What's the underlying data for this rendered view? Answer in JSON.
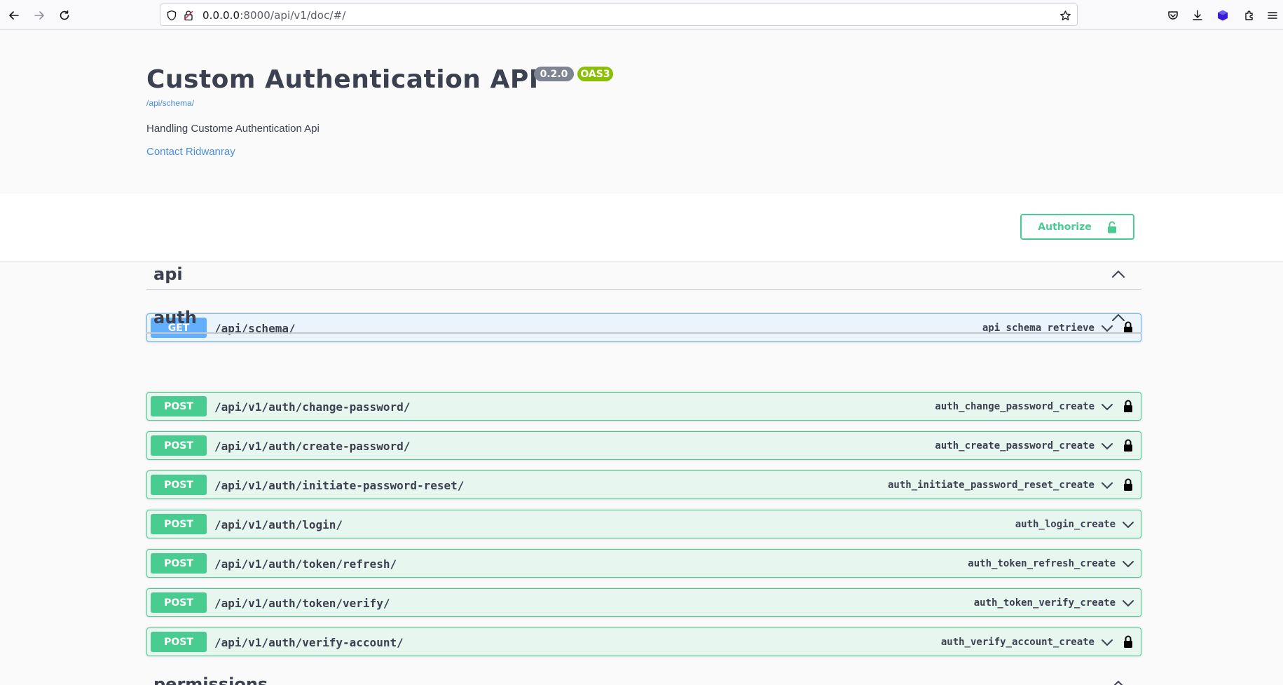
{
  "browser": {
    "url_host": "0.0.0.0",
    "url_path": ":8000/api/v1/doc/#/"
  },
  "info": {
    "title": "Custom Authentication API",
    "version_badge": "0.2.0",
    "oas_badge": "OAS3",
    "schema_link": "/api/schema/",
    "description": "Handling Custome Authentication Api",
    "contact_link": "Contact Ridwanray"
  },
  "scheme": {
    "authorize_label": "Authorize"
  },
  "tags": [
    {
      "name": "api",
      "operations": [
        {
          "method": "GET",
          "path": "/api/schema/",
          "operation_id": "api_schema_retrieve",
          "locked": true
        }
      ]
    },
    {
      "name": "auth",
      "operations": [
        {
          "method": "POST",
          "path": "/api/v1/auth/change-password/",
          "operation_id": "auth_change_password_create",
          "locked": true
        },
        {
          "method": "POST",
          "path": "/api/v1/auth/create-password/",
          "operation_id": "auth_create_password_create",
          "locked": true
        },
        {
          "method": "POST",
          "path": "/api/v1/auth/initiate-password-reset/",
          "operation_id": "auth_initiate_password_reset_create",
          "locked": true
        },
        {
          "method": "POST",
          "path": "/api/v1/auth/login/",
          "operation_id": "auth_login_create",
          "locked": false
        },
        {
          "method": "POST",
          "path": "/api/v1/auth/token/refresh/",
          "operation_id": "auth_token_refresh_create",
          "locked": false
        },
        {
          "method": "POST",
          "path": "/api/v1/auth/token/verify/",
          "operation_id": "auth_token_verify_create",
          "locked": false
        },
        {
          "method": "POST",
          "path": "/api/v1/auth/verify-account/",
          "operation_id": "auth_verify_account_create",
          "locked": true
        }
      ]
    },
    {
      "name": "permissions",
      "operations": []
    }
  ],
  "colors": {
    "get": "#61affe",
    "post": "#49cc90",
    "link": "#4990e2",
    "oas_badge": "#89bf04",
    "version_badge": "#7d8492"
  }
}
